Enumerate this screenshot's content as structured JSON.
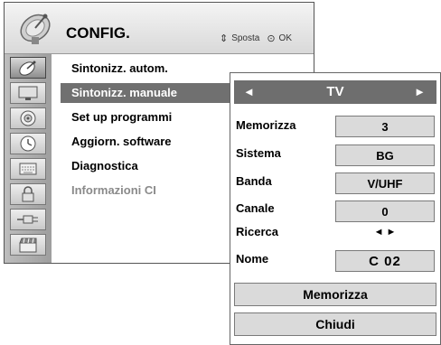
{
  "header": {
    "title": "CONFIG.",
    "hint_move_symbol": "⇕",
    "hint_move": "Sposta",
    "hint_ok_symbol": "⊙",
    "hint_ok": "OK"
  },
  "categories": [
    {
      "icon": "satellite-dish-icon",
      "active": true
    },
    {
      "icon": "monitor-icon",
      "active": false
    },
    {
      "icon": "speaker-icon",
      "active": false
    },
    {
      "icon": "clock-icon",
      "active": false
    },
    {
      "icon": "keyboard-icon",
      "active": false
    },
    {
      "icon": "lock-icon",
      "active": false
    },
    {
      "icon": "cable-plug-icon",
      "active": false
    },
    {
      "icon": "clapperboard-icon",
      "active": false
    }
  ],
  "menu": {
    "items": [
      {
        "label": "Sintonizz. autom."
      },
      {
        "label": "Sintonizz. manuale"
      },
      {
        "label": "Set up programmi"
      },
      {
        "label": "Aggiorn. software"
      },
      {
        "label": "Diagnostica"
      },
      {
        "label": "Informazioni CI"
      }
    ],
    "selected_index": 1,
    "disabled_index": 5
  },
  "sub": {
    "left_arrow": "◄",
    "right_arrow": "►",
    "source": "TV",
    "fields": {
      "memorizza_label": "Memorizza",
      "memorizza_value": "3",
      "sistema_label": "Sistema",
      "sistema_value": "BG",
      "banda_label": "Banda",
      "banda_value": "V/UHF",
      "canale_label": "Canale",
      "canale_value": "0",
      "ricerca_label": "Ricerca",
      "ricerca_value": "◄ ►",
      "nome_label": "Nome",
      "nome_value": "C  02"
    },
    "buttons": {
      "store": "Memorizza",
      "close": "Chiudi"
    }
  },
  "colors": {
    "selection": "#707070",
    "field_background": "#dadada",
    "disabled_text": "#8a8a8a"
  }
}
